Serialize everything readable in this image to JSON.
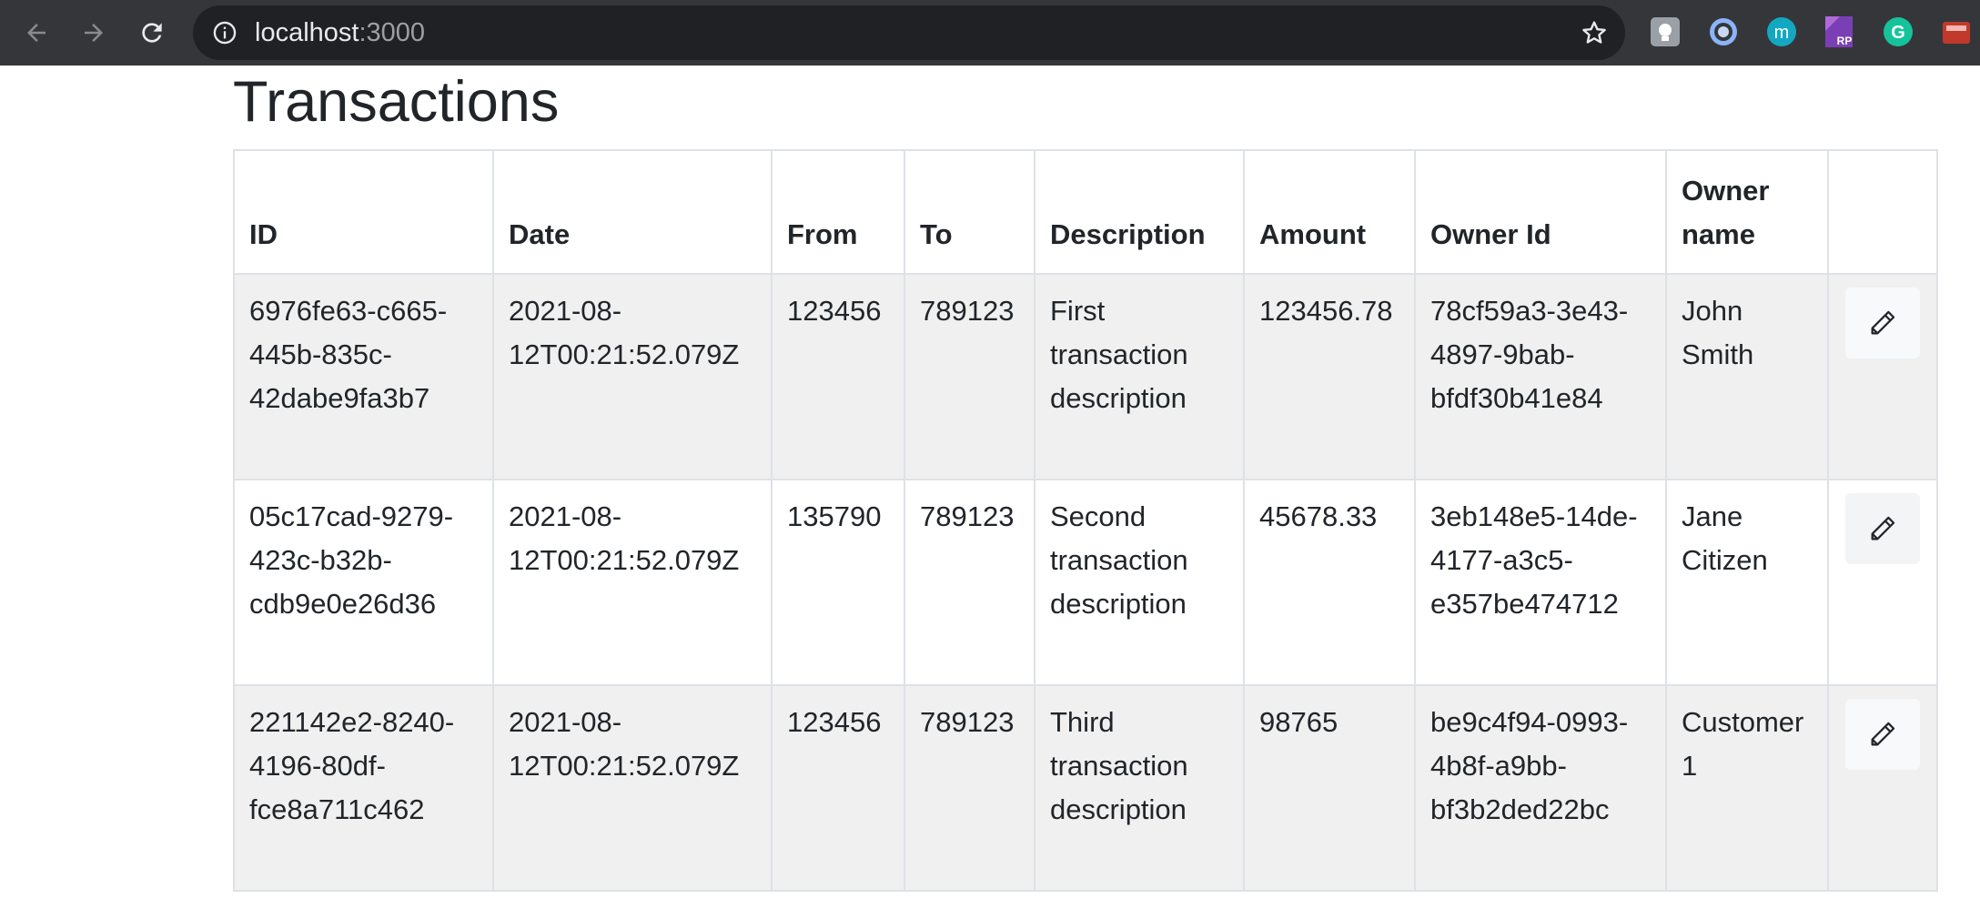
{
  "browser": {
    "url_host": "localhost",
    "url_port": ":3000",
    "icons": {
      "back": "arrow-left-icon",
      "forward": "arrow-right-icon",
      "reload": "reload-icon",
      "site_info": "info-icon",
      "bookmark": "star-icon"
    },
    "extensions": [
      {
        "name": "extension-icon",
        "color": "#9aa0a6"
      },
      {
        "name": "extension-icon",
        "color": "#8ab4f8"
      },
      {
        "name": "extension-icon",
        "color": "#13a8c1",
        "letter": "m"
      },
      {
        "name": "extension-icon",
        "color": "#7b3fb5",
        "letter": "RP"
      },
      {
        "name": "grammarly-icon",
        "color": "#15c39a",
        "letter": "G"
      },
      {
        "name": "extension-icon",
        "color": "#c0392b"
      }
    ]
  },
  "page": {
    "title": "Transactions"
  },
  "table": {
    "headers": [
      "ID",
      "Date",
      "From",
      "To",
      "Description",
      "Amount",
      "Owner Id",
      "Owner name",
      ""
    ],
    "rows": [
      {
        "id": "6976fe63-c665-445b-835c-42dabe9fa3b7",
        "date": "2021-08-12T00:21:52.079Z",
        "from": "123456",
        "to": "789123",
        "description": "First transaction description",
        "amount": "123456.78",
        "owner_id": "78cf59a3-3e43-4897-9bab-bfdf30b41e84",
        "owner_name": "John Smith",
        "action_icon": "pencil-icon"
      },
      {
        "id": "05c17cad-9279-423c-b32b-cdb9e0e26d36",
        "date": "2021-08-12T00:21:52.079Z",
        "from": "135790",
        "to": "789123",
        "description": "Second transaction description",
        "amount": "45678.33",
        "owner_id": "3eb148e5-14de-4177-a3c5-e357be474712",
        "owner_name": "Jane Citizen",
        "action_icon": "pencil-icon"
      },
      {
        "id": "221142e2-8240-4196-80df-fce8a711c462",
        "date": "2021-08-12T00:21:52.079Z",
        "from": "123456",
        "to": "789123",
        "description": "Third transaction description",
        "amount": "98765",
        "owner_id": "be9c4f94-0993-4b8f-a9bb-bf3b2ded22bc",
        "owner_name": "Customer 1",
        "action_icon": "pencil-icon"
      }
    ]
  }
}
